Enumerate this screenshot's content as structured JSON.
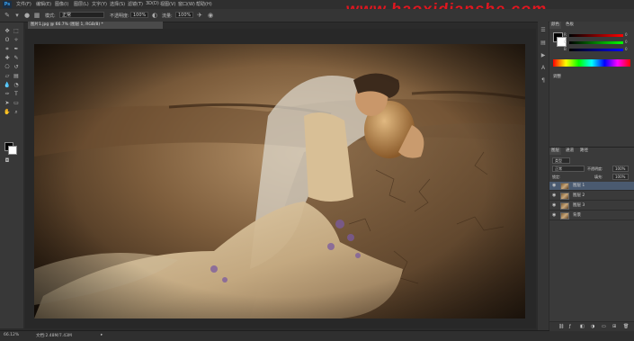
{
  "app": {
    "logo": "Ps"
  },
  "menu": [
    "文件(F)",
    "编辑(E)",
    "图像(I)",
    "图层(L)",
    "文字(Y)",
    "选择(S)",
    "滤镜(T)",
    "3D(D)",
    "视图(V)",
    "窗口(W)",
    "帮助(H)"
  ],
  "watermark": "www.haoxidianshe.com",
  "options": {
    "mode_label": "模式:",
    "mode_value": "正常",
    "opacity_label": "不透明度:",
    "opacity_value": "100%",
    "flow_label": "流量:",
    "flow_value": "100%"
  },
  "document": {
    "tab_title": "图片1.jpg @ 66.7% (图层 1, RGB/8) *"
  },
  "status": {
    "zoom": "66.12%",
    "doc_size": "文档:2.48M/7.43M"
  },
  "color_panel": {
    "tabs": [
      "颜色",
      "色板"
    ],
    "channels": [
      "R",
      "G",
      "B"
    ],
    "values": [
      "0",
      "0",
      "0"
    ],
    "adjust_title": "调整"
  },
  "layers_panel": {
    "tabs": [
      "图层",
      "通道",
      "路径"
    ],
    "search_label": "类型",
    "blend_mode": "正常",
    "opacity_label": "不透明度:",
    "opacity_value": "100%",
    "lock_label": "锁定:",
    "fill_label": "填充:",
    "fill_value": "100%",
    "layers": [
      {
        "name": "图层 1",
        "selected": true,
        "white": false
      },
      {
        "name": "图层 2",
        "selected": false,
        "white": false
      },
      {
        "name": "图层 3",
        "selected": false,
        "white": false
      },
      {
        "name": "背景",
        "selected": false,
        "white": false
      }
    ]
  },
  "colors": {
    "watermark": "#e0161f",
    "selection": "#4a5a70",
    "ui_bg": "#2b2b2b"
  }
}
